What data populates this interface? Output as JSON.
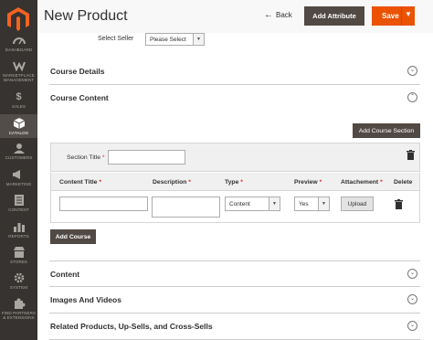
{
  "sidebar": {
    "logo": "magento-logo-icon",
    "items": [
      {
        "label": "DASHBOARD",
        "icon": "dashboard-icon",
        "active": false
      },
      {
        "label": "MARKETPLACE MANAGEMENT",
        "icon": "marketplace-icon",
        "active": false
      },
      {
        "label": "SALES",
        "icon": "dollar-icon",
        "active": false
      },
      {
        "label": "CATALOG",
        "icon": "cube-icon",
        "active": true
      },
      {
        "label": "CUSTOMERS",
        "icon": "customers-icon",
        "active": false
      },
      {
        "label": "MARKETING",
        "icon": "megaphone-icon",
        "active": false
      },
      {
        "label": "CONTENT",
        "icon": "content-icon",
        "active": false
      },
      {
        "label": "REPORTS",
        "icon": "bar-chart-icon",
        "active": false
      },
      {
        "label": "STORES",
        "icon": "store-icon",
        "active": false
      },
      {
        "label": "SYSTEM",
        "icon": "gear-icon",
        "active": false
      },
      {
        "label": "FIND PARTNERS & EXTENSIONS",
        "icon": "puzzle-icon",
        "active": false
      }
    ]
  },
  "header": {
    "title": "New Product",
    "back_label": "Back",
    "add_attribute_label": "Add Attribute",
    "save_label": "Save"
  },
  "seller": {
    "label": "Select Seller",
    "value": "Please Select"
  },
  "sections": {
    "course_details": "Course Details",
    "course_content": "Course Content",
    "content": "Content",
    "images_videos": "Images And Videos",
    "related": "Related Products, Up-Sells, and Cross-Sells"
  },
  "course_content": {
    "add_section_label": "Add Course Section",
    "section_title_label": "Section Title",
    "section_title_value": "",
    "required_mark": "*",
    "columns": {
      "content_title": "Content Title",
      "description": "Description",
      "type": "Type",
      "preview": "Preview",
      "attachment": "Attachement",
      "delete": "Delete"
    },
    "row": {
      "content_title_value": "",
      "description_value": "",
      "type_value": "Content",
      "preview_value": "Yes",
      "upload_label": "Upload"
    },
    "add_course_label": "Add Course"
  },
  "colors": {
    "sidebar_bg": "#373330",
    "accent": "#eb5202",
    "dark_button": "#514943"
  }
}
